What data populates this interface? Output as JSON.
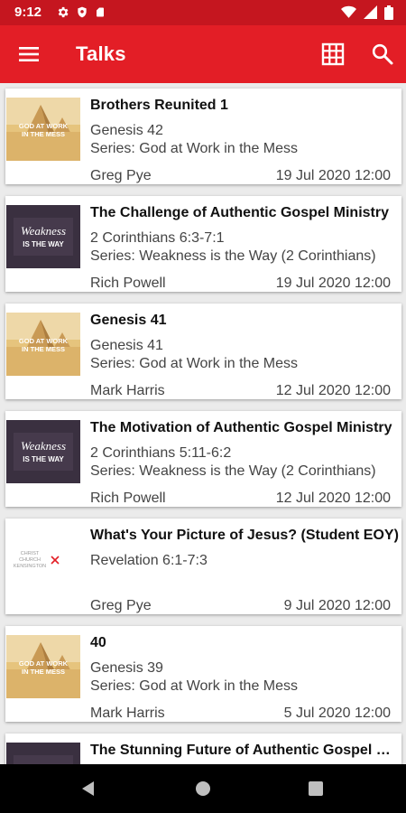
{
  "status_bar": {
    "time": "9:12",
    "left_icons": [
      "gear-icon",
      "shield-icon",
      "sd-card-icon"
    ],
    "right_icons": [
      "wifi-icon",
      "signal-icon",
      "battery-icon"
    ]
  },
  "app_bar": {
    "title": "Talks",
    "background": "#e31e26",
    "icons": [
      "menu-icon",
      "grid-icon",
      "search-icon"
    ]
  },
  "talks": [
    {
      "title": "Brothers Reunited 1",
      "reference": "Genesis 42",
      "series": "Series: God at Work in the Mess",
      "speaker": "Greg Pye",
      "date": "19 Jul 2020 12:00",
      "artwork": "god-at-work"
    },
    {
      "title": "The Challenge of Authentic Gospel Ministry",
      "reference": "2 Corinthians 6:3-7:1",
      "series": "Series: Weakness is the Way (2 Corinthians)",
      "speaker": "Rich Powell",
      "date": "19 Jul 2020 12:00",
      "artwork": "weakness"
    },
    {
      "title": "Genesis 41",
      "reference": "Genesis 41",
      "series": "Series: God at Work in the Mess",
      "speaker": "Mark Harris",
      "date": "12 Jul 2020 12:00",
      "artwork": "god-at-work"
    },
    {
      "title": "The Motivation of Authentic Gospel Ministry",
      "reference": "2 Corinthians 5:11-6:2",
      "series": "Series: Weakness is the Way (2 Corinthians)",
      "speaker": "Rich Powell",
      "date": "12 Jul 2020 12:00",
      "artwork": "weakness"
    },
    {
      "title": "What's Your Picture of Jesus? (Student EOY)",
      "reference": "Revelation 6:1-7:3",
      "series": "",
      "speaker": "Greg Pye",
      "date": "9 Jul 2020 12:00",
      "artwork": "church-logo"
    },
    {
      "title": "40",
      "reference": "Genesis 39",
      "series": "Series: God at Work in the Mess",
      "speaker": "Mark Harris",
      "date": "5 Jul 2020 12:00",
      "artwork": "god-at-work"
    },
    {
      "title": "The Stunning Future of Authentic Gospel Ministry",
      "reference": "",
      "series": "",
      "speaker": "",
      "date": "",
      "artwork": "weakness"
    }
  ],
  "artwork_text": {
    "god_at_work": [
      "GOD AT WORK",
      "IN THE MESS"
    ],
    "weakness_1": "Weakness",
    "weakness_2": "IS THE WAY",
    "church_logo": [
      "CHRIST",
      "CHURCH",
      "KENSINGTON"
    ]
  },
  "nav_bar": {
    "icons": [
      "back-icon",
      "home-icon",
      "recents-icon"
    ]
  }
}
